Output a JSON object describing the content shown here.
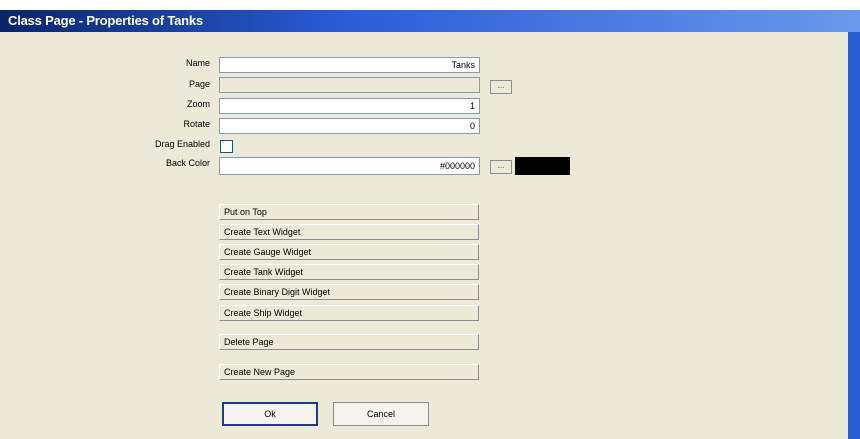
{
  "window": {
    "title": "Class Page - Properties of Tanks"
  },
  "form": {
    "name_label": "Name",
    "name_value": "Tanks",
    "page_label": "Page",
    "page_value": "",
    "zoom_label": "Zoom",
    "zoom_value": "1",
    "rotate_label": "Rotate",
    "rotate_value": "0",
    "drag_label": "Drag Enabled",
    "drag_checked": false,
    "backcolor_label": "Back Color",
    "backcolor_value": "#000000",
    "backcolor_swatch": "#000000",
    "browse_label": "..."
  },
  "actions": {
    "put_on_top": "Put on Top",
    "create_text": "Create Text Widget",
    "create_gauge": "Create Gauge Widget",
    "create_tank": "Create Tank Widget",
    "create_binary": "Create Binary Digit Widget",
    "create_ship": "Create Ship Widget",
    "delete_page": "Delete Page",
    "create_new_page": "Create New Page"
  },
  "dialog": {
    "ok": "Ok",
    "cancel": "Cancel"
  },
  "colors": {
    "titlebar": "#2a5cd6",
    "background": "#ece9d8"
  }
}
